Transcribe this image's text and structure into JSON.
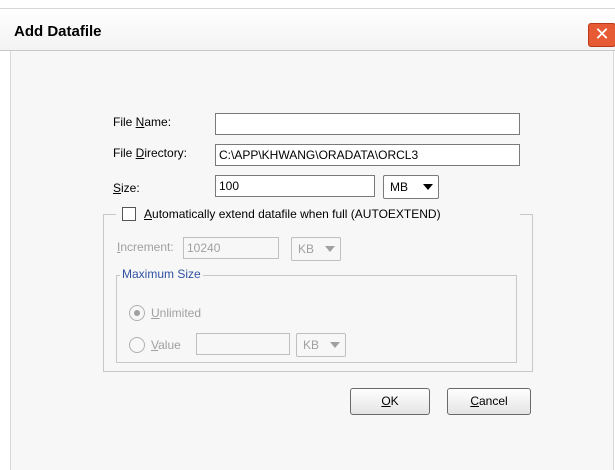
{
  "dialog": {
    "title": "Add Datafile",
    "close_glyph": "✕"
  },
  "form": {
    "file_name": {
      "label_pre": "File ",
      "label_key": "N",
      "label_post": "ame:",
      "value": ""
    },
    "file_directory": {
      "label_pre": "File ",
      "label_key": "D",
      "label_post": "irectory:",
      "value": "C:\\APP\\KHWANG\\ORADATA\\ORCL3"
    },
    "size": {
      "label_key": "S",
      "label_post": "ize:",
      "value": "100",
      "unit": "MB"
    },
    "autoextend": {
      "checked": false,
      "label_key": "A",
      "label_post": "utomatically extend datafile when full (AUTOEXTEND)"
    },
    "increment": {
      "label_key": "I",
      "label_post": "ncrement:",
      "value": "10240",
      "unit": "KB"
    },
    "maximum_size": {
      "title": "Maximum Size",
      "unlimited": {
        "label_key": "U",
        "label_post": "nlimited",
        "selected": true
      },
      "value_option": {
        "label_key": "V",
        "label_post": "alue",
        "selected": false,
        "value": "",
        "unit": "KB"
      }
    }
  },
  "buttons": {
    "ok": {
      "label_key": "O",
      "label_post": "K"
    },
    "cancel": {
      "label_key": "C",
      "label_post": "ancel"
    }
  },
  "icons": {
    "dropdown": "chevron-down-icon",
    "close": "close-icon"
  }
}
